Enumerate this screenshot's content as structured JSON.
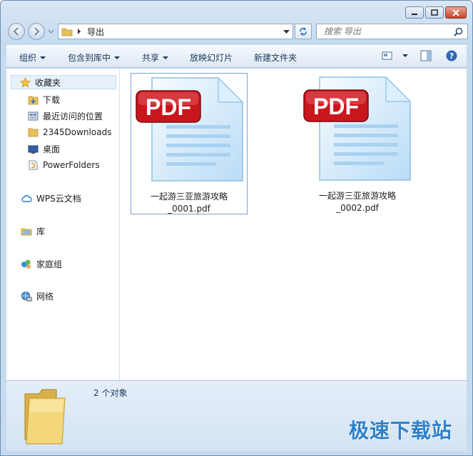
{
  "address": {
    "path": "导出"
  },
  "search": {
    "placeholder": "搜索 导出"
  },
  "toolbar": {
    "organize": "组织",
    "include_in_library": "包含到库中",
    "share": "共享",
    "slideshow": "放映幻灯片",
    "new_folder": "新建文件夹"
  },
  "nav": {
    "favorites": "收藏夹",
    "downloads": "下载",
    "recent": "最近访问的位置",
    "downloads2345": "2345Downloads",
    "desktop": "桌面",
    "powerfolders": "PowerFolders",
    "wps": "WPS云文档",
    "library": "库",
    "homegroup": "家庭组",
    "network": "网络"
  },
  "files": [
    {
      "line1": "一起游三亚旅游攻略",
      "line2": "_0001.pdf",
      "badge": "PDF"
    },
    {
      "line1": "一起游三亚旅游攻略",
      "line2": "_0002.pdf",
      "badge": "PDF"
    }
  ],
  "details": {
    "count": "2 个对象"
  },
  "watermark": "极速下载站",
  "colors": {
    "pdf_red": "#c8161d",
    "accent": "#2f80c8"
  }
}
